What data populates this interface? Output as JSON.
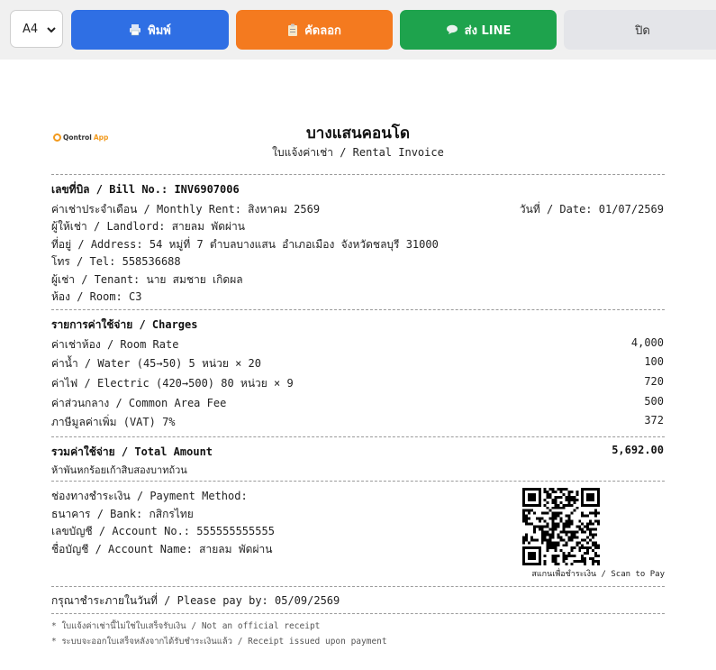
{
  "toolbar": {
    "paper_size": "A4",
    "print_label": "พิมพ์",
    "copy_label": "คัดลอก",
    "line_label": "ส่ง LINE",
    "close_label": "ปิด"
  },
  "brand": {
    "logo_text": "Qontrol",
    "logo_suffix": "App"
  },
  "invoice": {
    "title": "บางแสนคอนโด",
    "subtitle": "ใบแจ้งค่าเช่า / Rental Invoice",
    "bill_no": "เลขที่บิล / Bill No.: INV6907006",
    "monthly_rent": "ค่าเช่าประจำเดือน / Monthly Rent: สิงหาคม 2569",
    "date": "วันที่ / Date: 01/07/2569",
    "landlord": "ผู้ให้เช่า / Landlord: สายลม พัดผ่าน",
    "address": "ที่อยู่ / Address: 54 หมู่ที่ 7 ตำบลบางแสน อำเภอเมือง จังหวัดชลบุรี 31000",
    "tel": "โทร / Tel: 558536688",
    "tenant": "ผู้เช่า / Tenant: นาย สมชาย เกิดผล",
    "room": "ห้อง / Room: C3",
    "charges_header": "รายการค่าใช้จ่าย / Charges",
    "charges": [
      {
        "label": "ค่าเช่าห้อง / Room Rate",
        "amount": "4,000"
      },
      {
        "label": "ค่าน้ำ / Water (45→50) 5 หน่วย × 20",
        "amount": "100"
      },
      {
        "label": "ค่าไฟ / Electric (420→500) 80 หน่วย × 9",
        "amount": "720"
      },
      {
        "label": "ค่าส่วนกลาง / Common Area Fee",
        "amount": "500"
      },
      {
        "label": "ภาษีมูลค่าเพิ่ม (VAT) 7%",
        "amount": "372"
      }
    ],
    "total_label": "รวมค่าใช้จ่าย / Total Amount",
    "total_amount": "5,692.00",
    "total_words": "ห้าพันหกร้อยเก้าสิบสองบาทถ้วน",
    "payment_method": "ช่องทางชำระเงิน / Payment Method:",
    "bank": "ธนาคาร / Bank: กสิกรไทย",
    "account_no": "เลขบัญชี / Account No.: 555555555555",
    "account_name": "ชื่อบัญชี / Account Name: สายลม พัดผ่าน",
    "qr_caption": "สแกนเพื่อชำระเงิน / Scan to Pay",
    "pay_by": "กรุณาชำระภายในวันที่ / Please pay by: 05/09/2569",
    "note1": "* ใบแจ้งค่าเช่านี้ไม่ใช่ใบเสร็จรับเงิน / Not an official receipt",
    "note2": "* ระบบจะออกใบเสร็จหลังจากได้รับชำระเงินแล้ว / Receipt issued upon payment"
  },
  "colors": {
    "print": "#2f6fe4",
    "copy": "#f47a1f",
    "line": "#1ea34d",
    "close": "#e4e5e9",
    "brand": "#f29a1d"
  }
}
